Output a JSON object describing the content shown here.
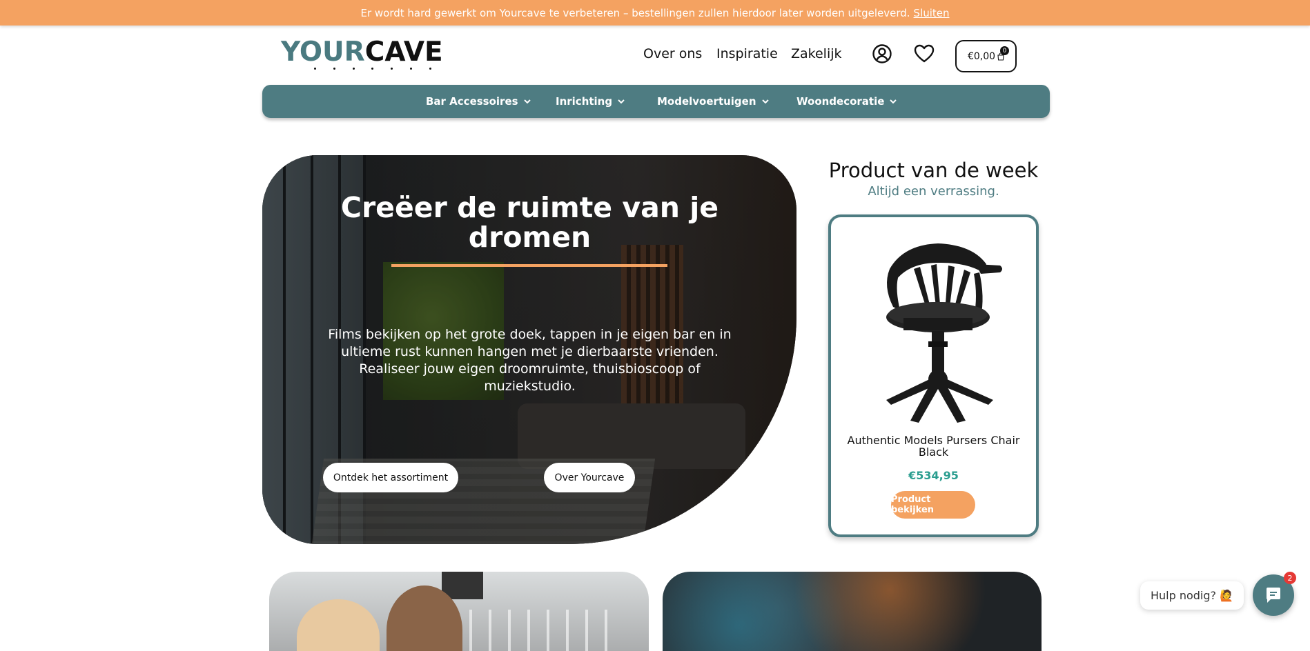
{
  "notice": {
    "text": "Er wordt hard gewerkt om Yourcave te verbeteren – bestellingen zullen hierdoor later worden uitgeleverd.",
    "dismiss": "Sluiten"
  },
  "header": {
    "logo_part1": "YOUR",
    "logo_part2": "CAVE",
    "nav": [
      "Over ons",
      "Inspiratie",
      "Zakelijk"
    ],
    "cart_total": "€0,00",
    "cart_count": "0"
  },
  "categories": [
    "Bar Accessoires",
    "Inrichting",
    "Modelvoertuigen",
    "Woondecoratie"
  ],
  "hero": {
    "title": "Creëer de ruimte van je dromen",
    "text": "Films bekijken op het grote doek, tappen in je eigen bar en in ultieme rust kunnen hangen met je dierbaarste vrienden. Realiseer jouw eigen droomruimte, thuisbioscoop of muziekstudio.",
    "button_primary": "Ontdek het assortiment",
    "button_secondary": "Over Yourcave"
  },
  "product_week": {
    "title": "Product van de week",
    "subtitle": "Altijd een verrassing.",
    "name": "Authentic Models Pursers Chair Black",
    "price": "€534,95",
    "button": "Product bekijken"
  },
  "help": {
    "label": "Hulp nodig? 🙋",
    "badge": "2"
  },
  "colors": {
    "accent_orange": "#f4a261",
    "brand_teal": "#4e7c82",
    "price_green": "#2a9d8f"
  }
}
